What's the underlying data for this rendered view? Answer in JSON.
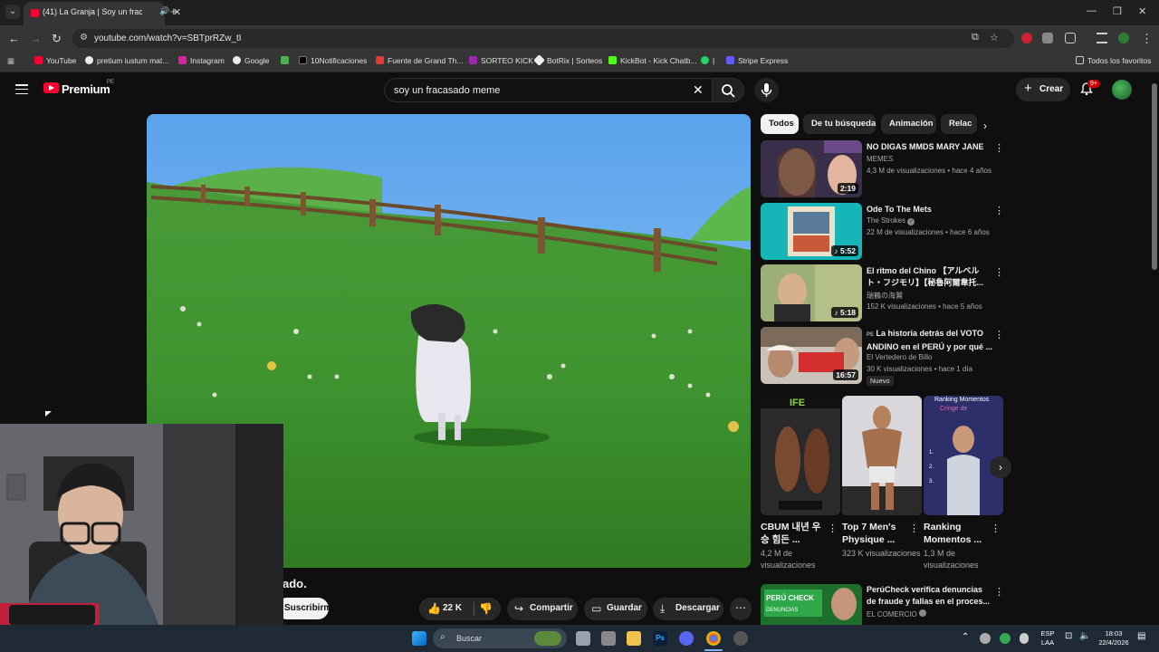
{
  "browser": {
    "tab_title": "(41) La Granja | Soy un frac",
    "url": "youtube.com/watch?v=SBTprRZw_tI",
    "bookmarks": [
      "YouTube",
      "pretium iustum mat...",
      "Instagram",
      "Google",
      "10Notificaciones",
      "Fuente de Grand Th...",
      "SORTEO KICK",
      "BotRix | Sorteos",
      "KickBot - Kick Chatb...",
      "Stripe Express"
    ],
    "bookmarks_folder": "Todos los favoritos"
  },
  "youtube": {
    "logo_text": "Premium",
    "region": "PE",
    "search_query": "soy un fracasado meme",
    "create_label": "Crear",
    "notifications": "9+"
  },
  "video": {
    "title_visible": "ado.",
    "subscribe_label": "Suscribirme",
    "likes": "22 K",
    "share_label": "Compartir",
    "save_label": "Guardar",
    "download_label": "Descargar"
  },
  "chips": [
    "Todos",
    "De tu búsqueda",
    "Animación",
    "Relac"
  ],
  "related": [
    {
      "title": "NO DIGAS MMDS MARY JANE",
      "channel": "MEMES",
      "meta": "4,3 M de visualizaciones • hace 4 años",
      "duration": "2:19"
    },
    {
      "title": "Ode To The Mets",
      "channel": "The Strokes",
      "meta": "22 M de visualizaciones • hace 6 años",
      "duration": "♪ 5:52"
    },
    {
      "title": "El ritmo del Chino 【アルベルト・フジモリ】【秘魯阿爾韋托...",
      "channel": "瑞鶴の海鷲",
      "meta": "152 K visualizaciones • hace 5 años",
      "duration": "♪ 5:18"
    },
    {
      "title": "La historia detrás del VOTO ANDINO en el PERÚ y por qué ...",
      "title_prefix": "PE",
      "channel": "El Vertedero de Billo",
      "meta": "30 K visualizaciones • hace 1 día",
      "duration": "16:57",
      "badge": "Nuevo"
    },
    {
      "title": "PerúCheck verifica denuncias de fraude y fallas en el proces...",
      "channel": "EL COMERCIO",
      "meta": ""
    }
  ],
  "shorts": [
    {
      "title": "CBUM 내년 우승 힘든 ...",
      "views": "4,2 M de visualizaciones"
    },
    {
      "title": "Top 7 Men's Physique ...",
      "views": "323 K visualizaciones"
    },
    {
      "title": "Ranking Momentos ...",
      "views": "1,3 M de visualizaciones"
    }
  ],
  "taskbar": {
    "search_label": "Buscar",
    "lang": "ESP",
    "lang2": "LAA",
    "time": "18:03",
    "date": "22/4/2026"
  },
  "colors": {
    "yt_red": "#ff0033",
    "bg": "#0f0f0f",
    "chip_active": "#f1f1f1"
  }
}
